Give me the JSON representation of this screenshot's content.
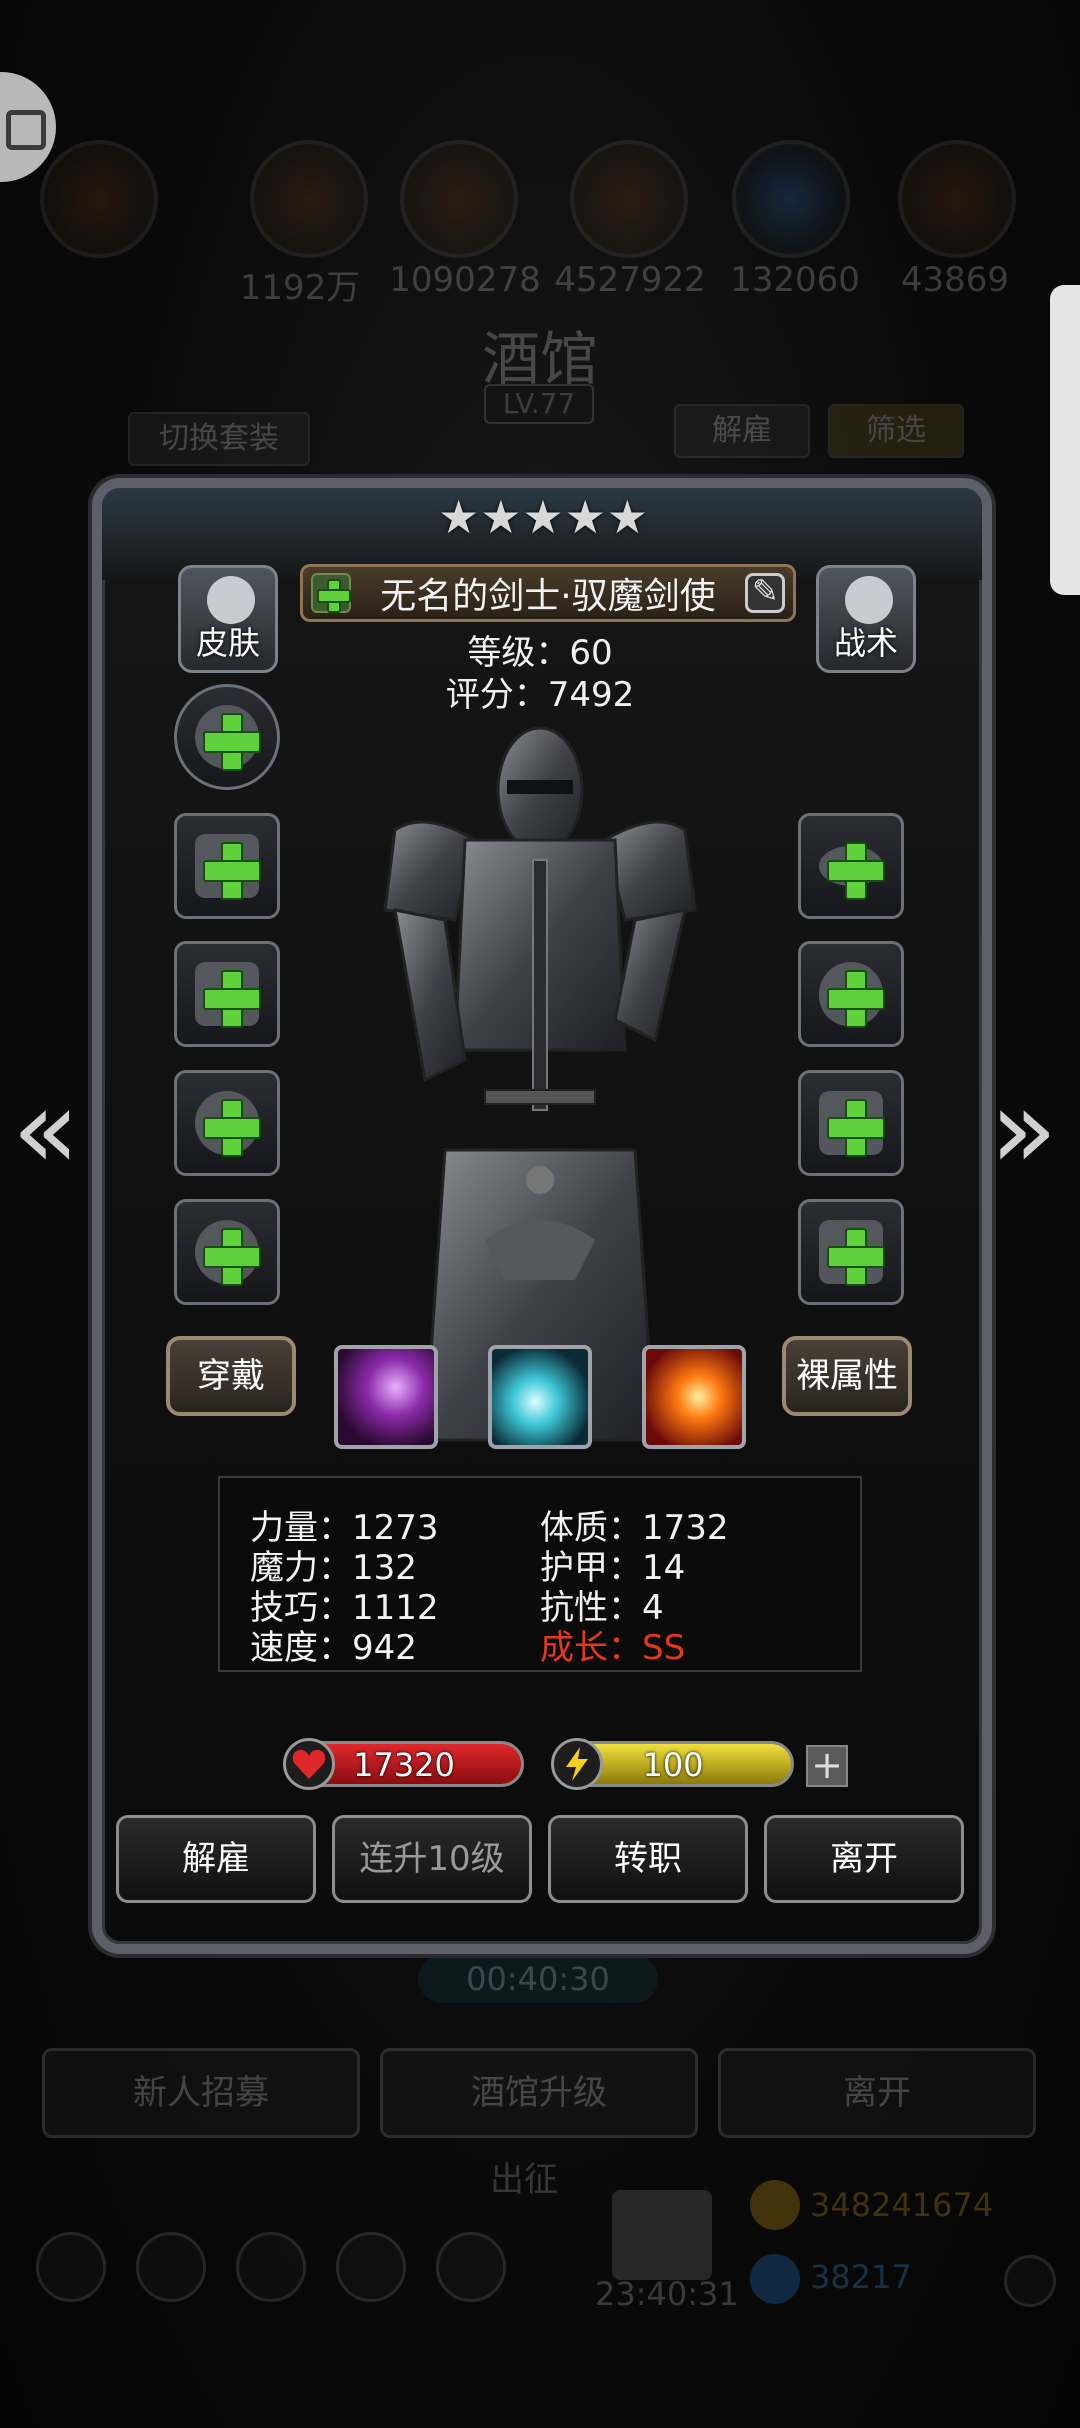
{
  "background": {
    "resources": [
      "1192万",
      "1090278",
      "4527922",
      "132060",
      "43869"
    ],
    "title": "酒馆",
    "level": "LV.77",
    "switch_outfit": "切换套装",
    "dismiss": "解雇",
    "filter": "筛选",
    "timer": "00:40:30",
    "buttons": [
      "新人招募",
      "酒馆升级",
      "离开"
    ],
    "sortie": "出征",
    "time2": "23:40:31",
    "gold": "348241674",
    "gems": "38217"
  },
  "hero": {
    "stars": 5,
    "name": "无名的剑士·驭魔剑使",
    "level_text": "等级：60",
    "score_text": "评分：7492"
  },
  "buttons": {
    "skin": "皮肤",
    "tactics": "战术",
    "wear": "穿戴",
    "naked": "裸属性"
  },
  "stats": {
    "strength": "力量：1273",
    "constitution": "体质：1732",
    "magic": "魔力：132",
    "armor": "护甲：14",
    "skill": "技巧：1112",
    "resist": "抗性：4",
    "speed": "速度：942",
    "growth": "成长：SS"
  },
  "bars": {
    "hp": "17320",
    "energy": "100"
  },
  "actions": [
    "解雇",
    "连升10级",
    "转职",
    "离开"
  ],
  "colors": {
    "growth": "#e4391d",
    "hp": "#c8161a",
    "energy": "#d6c21a",
    "plus": "#5fd13a"
  }
}
